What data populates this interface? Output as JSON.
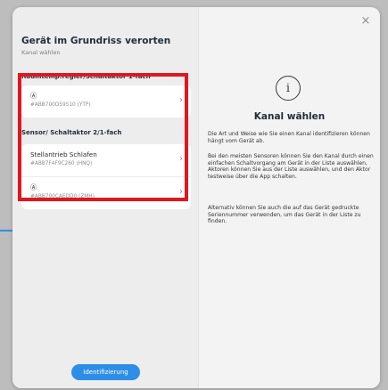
{
  "window": {
    "close_icon": "close-icon",
    "close_glyph": "×"
  },
  "left": {
    "title": "Gerät im Grundriss verorten",
    "subtitle": "Kanal wählen",
    "groups": [
      {
        "label": "Raumtemp.regler/Schaltaktor 1-fach",
        "items": [
          {
            "main": "Ⓐ",
            "sub": "#ABB700D59510 (YTP)"
          }
        ]
      },
      {
        "label": "Sensor/ Schaltaktor 2/1-fach",
        "items": [
          {
            "main": "Stellantrieb Schlafen",
            "sub": "#ABB7F4F9C260 (HNQ)"
          },
          {
            "main": "Ⓐ",
            "sub": "#ABB700CAEDD0 (ZMH)"
          }
        ]
      }
    ],
    "identify_button": "Identifizierung"
  },
  "right": {
    "info_icon": "info-icon",
    "info_glyph": "i",
    "title": "Kanal wählen",
    "paragraphs": [
      "Die Art und Weise wie Sie einen Kanal identifizieren können hängt vom Gerät ab.",
      "Bei den meisten Sensoren können Sie den Kanal durch einen einfachen Schaltvorgang am Gerät in der Liste auswählen. Aktoren können Sie aus der Liste auswählen, und den Aktor testweise über die App schalten.",
      "Alternativ können Sie auch die auf das Gerät gedruckte Seriennummer verwenden, um das Gerät in der Liste zu finden."
    ]
  },
  "colors": {
    "accent": "#2d8ee8",
    "highlight": "#e0171f"
  },
  "icons": {
    "chevron": "chevron-right-icon",
    "chevron_glyph": "›"
  }
}
